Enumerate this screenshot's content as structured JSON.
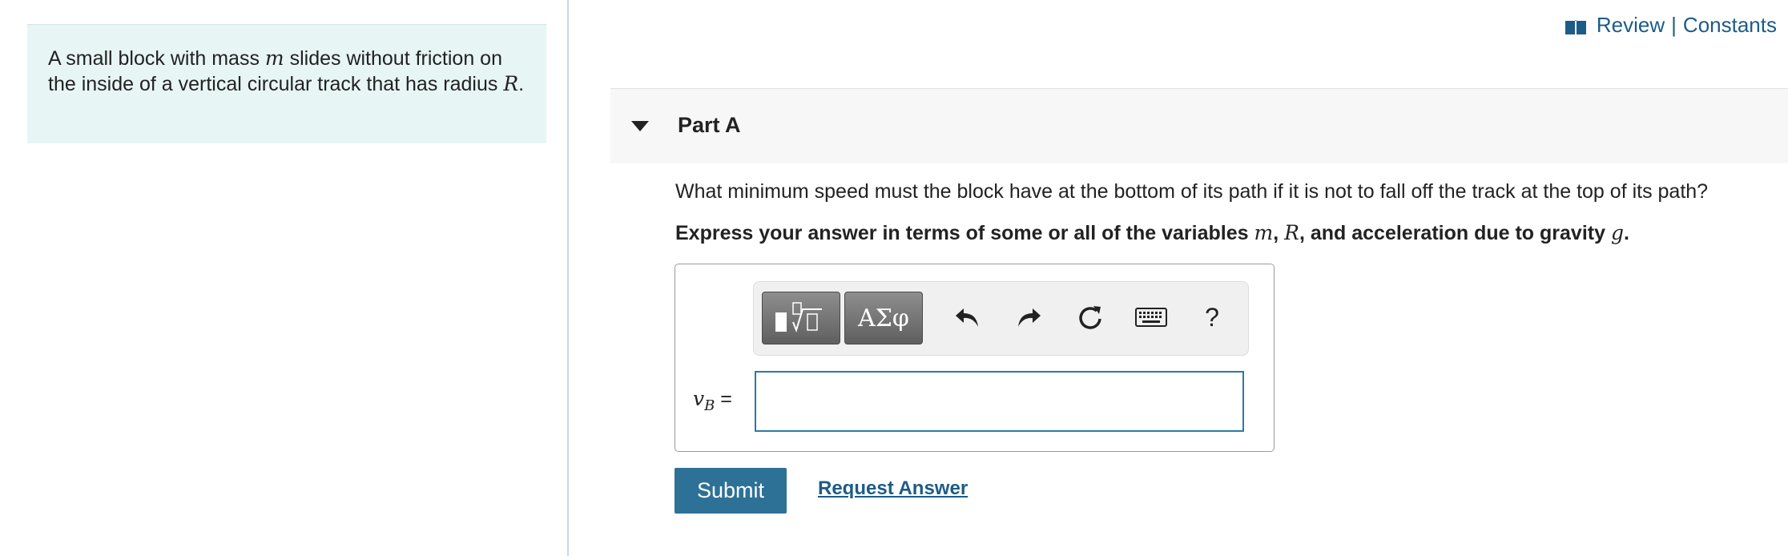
{
  "intro": {
    "text_1": "A small block with mass ",
    "var_m": "m",
    "text_2": " slides without friction on the inside of a vertical circular track that has radius ",
    "var_R": "R",
    "text_3": "."
  },
  "topnav": {
    "review_label": "Review",
    "separator": "|",
    "constants_label": "Constants",
    "icon": "book-icon"
  },
  "part": {
    "title": "Part A",
    "question": "What minimum speed must the block have at the bottom of its path if it is not to fall off the track at the top of its path?",
    "instruction_pre": "Express your answer in terms of some or all of the variables ",
    "var_m": "m",
    "comma_1": ", ",
    "var_R": "R",
    "instruction_mid": ", and acceleration due to gravity ",
    "var_g": "g",
    "instruction_end": "."
  },
  "toolbar": {
    "greek_label": "ΑΣφ",
    "help_label": "?",
    "icons": [
      "templates-icon",
      "greek-icon",
      "undo-icon",
      "redo-icon",
      "reset-icon",
      "keyboard-icon",
      "help-icon"
    ]
  },
  "answer": {
    "var_base": "v",
    "var_sub": "B",
    "equals": " =",
    "value": ""
  },
  "actions": {
    "submit_label": "Submit",
    "request_label": "Request Answer"
  },
  "colors": {
    "accent": "#2d7196",
    "link": "#1c5c86",
    "intro_bg": "#e8f5f5"
  }
}
